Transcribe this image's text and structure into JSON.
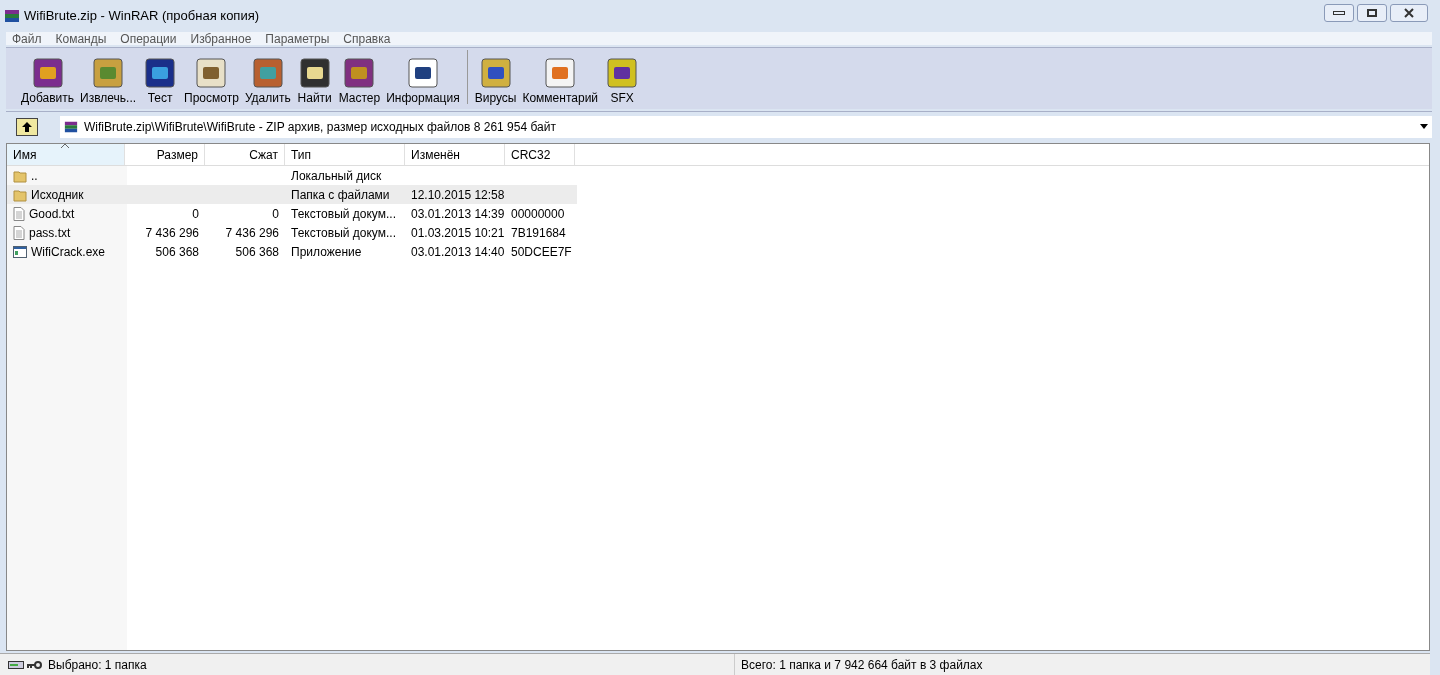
{
  "window": {
    "title": "WifiBrute.zip - WinRAR (пробная копия)"
  },
  "menu": [
    "Файл",
    "Команды",
    "Операции",
    "Избранное",
    "Параметры",
    "Справка"
  ],
  "toolbar": [
    {
      "label": "Добавить",
      "kind": "add"
    },
    {
      "label": "Извлечь...",
      "kind": "extract"
    },
    {
      "label": "Тест",
      "kind": "test"
    },
    {
      "label": "Просмотр",
      "kind": "view"
    },
    {
      "label": "Удалить",
      "kind": "delete"
    },
    {
      "label": "Найти",
      "kind": "find"
    },
    {
      "label": "Мастер",
      "kind": "wizard"
    },
    {
      "label": "Информация",
      "kind": "info"
    },
    {
      "label": "Вирусы",
      "kind": "virus",
      "separator_before": true
    },
    {
      "label": "Комментарий",
      "kind": "comment"
    },
    {
      "label": "SFX",
      "kind": "sfx"
    }
  ],
  "address": {
    "path": "WifiBrute.zip\\WifiBrute\\WifiBrute - ZIP архив, размер исходных файлов 8 261 954 байт"
  },
  "table": {
    "columns": [
      {
        "label": "Имя",
        "sorted": true
      },
      {
        "label": "Размер",
        "sorted": false
      },
      {
        "label": "Сжат",
        "sorted": false
      },
      {
        "label": "Тип",
        "sorted": false
      },
      {
        "label": "Изменён",
        "sorted": false
      },
      {
        "label": "CRC32",
        "sorted": false
      }
    ],
    "rows": [
      {
        "kind": "folder",
        "selected": false,
        "cells": [
          "..",
          "",
          "",
          "Локальный диск",
          "",
          ""
        ]
      },
      {
        "kind": "folder",
        "selected": true,
        "cells": [
          "Исходник",
          "",
          "",
          "Папка с файлами",
          "12.10.2015 12:58",
          ""
        ]
      },
      {
        "kind": "text",
        "selected": false,
        "cells": [
          "Good.txt",
          "0",
          "0",
          "Текстовый докум...",
          "03.01.2013 14:39",
          "00000000"
        ]
      },
      {
        "kind": "text",
        "selected": false,
        "cells": [
          "pass.txt",
          "7 436 296",
          "7 436 296",
          "Текстовый докум...",
          "01.03.2015 10:21",
          "7B191684"
        ]
      },
      {
        "kind": "exe",
        "selected": false,
        "cells": [
          "WifiCrack.exe",
          "506 368",
          "506 368",
          "Приложение",
          "03.01.2013 14:40",
          "50DCEE7F"
        ]
      }
    ]
  },
  "status": {
    "left": "Выбрано: 1 папка",
    "right": "Всего: 1 папка и 7 942 664 байт в 3 файлах"
  }
}
